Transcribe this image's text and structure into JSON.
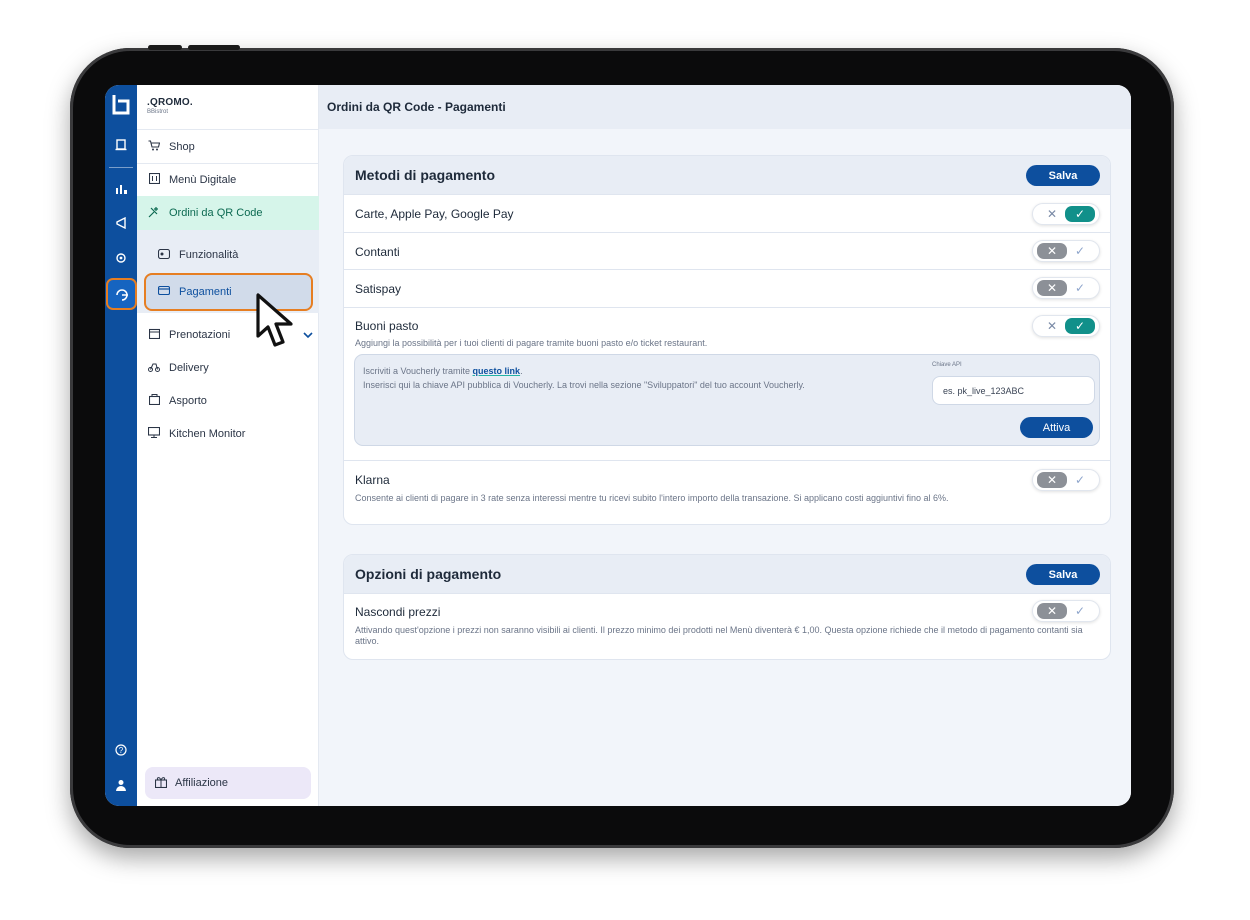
{
  "brand": {
    "name": ".QROMO.",
    "subtitle": "BBistrot"
  },
  "header": {
    "title": "Ordini da QR Code - Pagamenti"
  },
  "rail": {
    "logo": "b",
    "icons": [
      "receipt-icon",
      "chart-icon",
      "megaphone-icon",
      "settings-icon",
      "qr-orders-icon",
      "help-icon",
      "user-icon"
    ]
  },
  "sidebar": {
    "items": [
      {
        "label": "Shop",
        "icon": "cart-icon"
      },
      {
        "label": "Menù Digitale",
        "icon": "menu-icon"
      },
      {
        "label": "Ordini da QR Code",
        "icon": "qr-icon"
      },
      {
        "label": "Funzionalità",
        "icon": "features-icon"
      },
      {
        "label": "Pagamenti",
        "icon": "card-icon"
      },
      {
        "label": "Prenotazioni",
        "icon": "calendar-icon"
      },
      {
        "label": "Delivery",
        "icon": "scooter-icon"
      },
      {
        "label": "Asporto",
        "icon": "bag-icon"
      },
      {
        "label": "Kitchen Monitor",
        "icon": "monitor-icon"
      }
    ],
    "affiliate": "Affiliazione"
  },
  "metodi": {
    "title": "Metodi di pagamento",
    "save": "Salva",
    "rows": [
      {
        "title": "Carte, Apple Pay, Google Pay",
        "enabled": true
      },
      {
        "title": "Contanti",
        "enabled": false
      },
      {
        "title": "Satispay",
        "enabled": false
      },
      {
        "title": "Buoni pasto",
        "enabled": true,
        "desc": "Aggiungi la possibilità per i tuoi clienti di pagare tramite buoni pasto e/o ticket restaurant."
      },
      {
        "title": "Klarna",
        "enabled": false,
        "desc": "Consente ai clienti di pagare in 3 rate senza interessi mentre tu ricevi subito l'intero importo della transazione. Si applicano costi aggiuntivi fino al 6%."
      }
    ],
    "voucherly": {
      "line1_prefix": "Iscriviti a Voucherly tramite ",
      "link": "questo link",
      "line1_suffix": ".",
      "line2": "Inserisci qui la chiave API pubblica di Voucherly. La trovi nella sezione \"Sviluppatori\" del tuo account Voucherly.",
      "api_label": "Chiave API",
      "api_placeholder": "es. pk_live_123ABC",
      "activate": "Attiva"
    }
  },
  "opzioni": {
    "title": "Opzioni di pagamento",
    "save": "Salva",
    "rows": [
      {
        "title": "Nascondi prezzi",
        "enabled": false,
        "desc": "Attivando quest'opzione i prezzi non saranno visibili ai clienti. Il prezzo minimo dei prodotti nel Menù diventerà € 1,00. Questa opzione richiede che il metodo di pagamento contanti sia attivo."
      }
    ]
  },
  "toggle": {
    "off_symbol": "✕",
    "on_symbol": "✓"
  },
  "colors": {
    "primary": "#0d4f9e",
    "accent": "#11908a",
    "highlight": "#e67e22",
    "active_nav": "#d6f5ea"
  }
}
